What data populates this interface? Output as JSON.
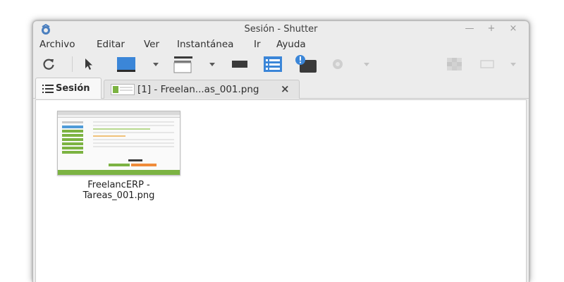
{
  "window": {
    "title": "Sesión - Shutter",
    "controls": {
      "minimize": "—",
      "maximize": "+",
      "close": "×"
    }
  },
  "menu": {
    "items": [
      "Archivo",
      "Editar",
      "Ver",
      "Instantánea",
      "Ir",
      "Ayuda"
    ]
  },
  "toolbar": {
    "icons": [
      "reload-icon",
      "pointer-icon",
      "desktop-icon",
      "window-icon",
      "menu-capture-icon",
      "tooltip-capture-icon",
      "web-capture-icon"
    ],
    "colors": {
      "accent": "#3b86d8",
      "dark": "#404040"
    }
  },
  "tabs": {
    "session_label": "Sesión",
    "screenshot_label": "[1] - Freelan...as_001.png",
    "close_symbol": "×"
  },
  "session": {
    "items": [
      {
        "name_line1": "FreelancERP -",
        "name_line2": "Tareas_001.png"
      }
    ]
  }
}
